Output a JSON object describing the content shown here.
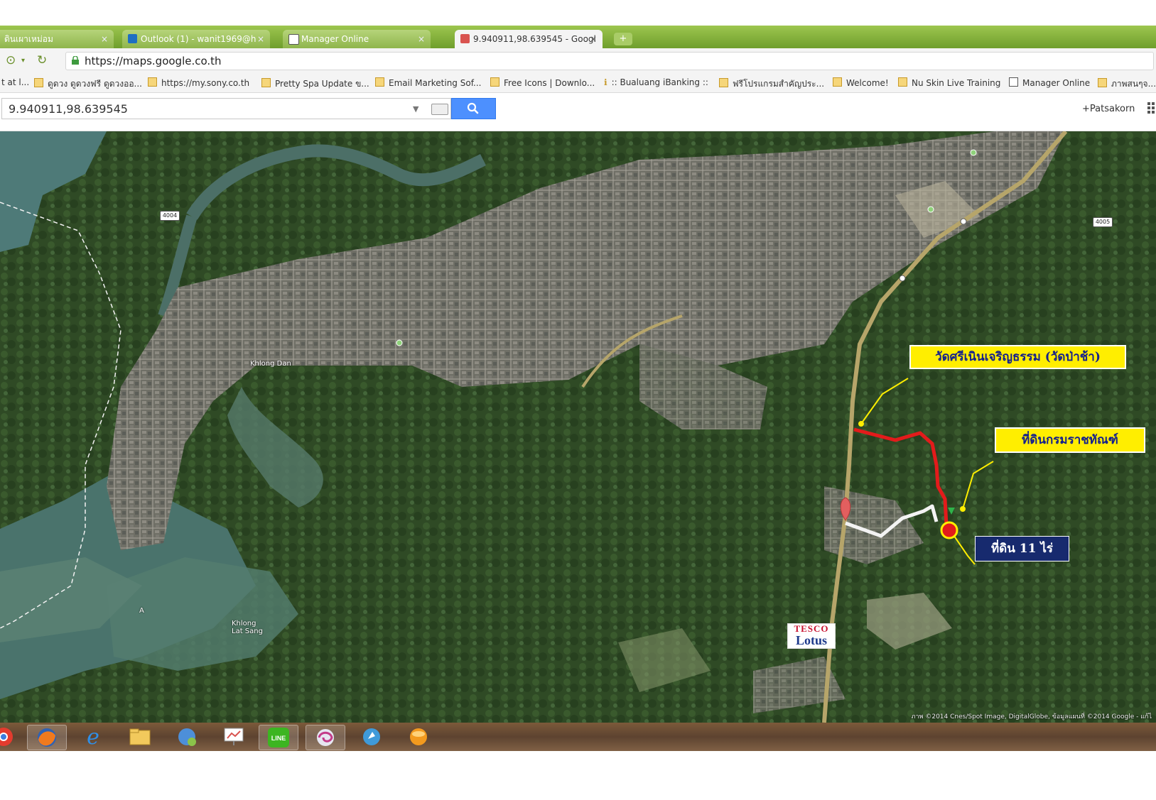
{
  "tabs": [
    {
      "label": "ดินเผาเหม่อม",
      "close": "×"
    },
    {
      "label": "Outlook (1) - wanit1969@h",
      "close": "×"
    },
    {
      "label": "Manager Online",
      "close": "×"
    },
    {
      "label": "9.940911,98.639545 - Googl",
      "close": "×"
    }
  ],
  "new_tab": "+",
  "address": {
    "url": "https://maps.google.co.th"
  },
  "bookmarks": [
    "t at l...",
    "ดูดวง ดูดวงฟรี ดูดวงออ...",
    "https://my.sony.co.th",
    "Pretty Spa Update ข...",
    "Email Marketing Sof...",
    "Free Icons | Downlo...",
    ":: Bualuang iBanking ::",
    "ฟรีโปรแกรมสำคัญประ...",
    "Welcome!",
    "Nu Skin Live Training",
    "Manager Online",
    "ภาพสนๆจ..."
  ],
  "search": {
    "value": "9.940911,98.639545"
  },
  "user": {
    "name": "+Patsakorn"
  },
  "map": {
    "callouts": [
      {
        "text": "วัดศรีเนินเจริญธรรม (วัดป่าช้า)"
      },
      {
        "text": "ที่ดินกรมราชทัณฑ์"
      },
      {
        "text": "ที่ดิน 11 ไร่"
      }
    ],
    "marker_label": "A",
    "tesco": {
      "line1": "TESCO",
      "line2": "Lotus"
    },
    "labels": {
      "khlong_dan": "Khlong Dan",
      "khlong_lat_sang": "Khlong\nLat Sang",
      "road_4004": "4004",
      "road_4005": "4005"
    },
    "copyright": "ภาพ ©2014 Cnes/Spot Image, DigitalGlobe, ข้อมูลแผนที่ ©2014 Google - แก้ไ",
    "colors": {
      "route_red": "#e31b1b",
      "route_white": "#f3f3f3",
      "callout_yellow": "#ffee00",
      "callout_navy": "#172a6e"
    }
  },
  "taskbar": {
    "icons": [
      "chrome-icon",
      "firefox-icon",
      "ie-icon",
      "explorer-icon",
      "network-icon",
      "presentation-icon",
      "line-icon",
      "swirl-icon",
      "messenger-icon",
      "orange-ball-icon"
    ]
  }
}
